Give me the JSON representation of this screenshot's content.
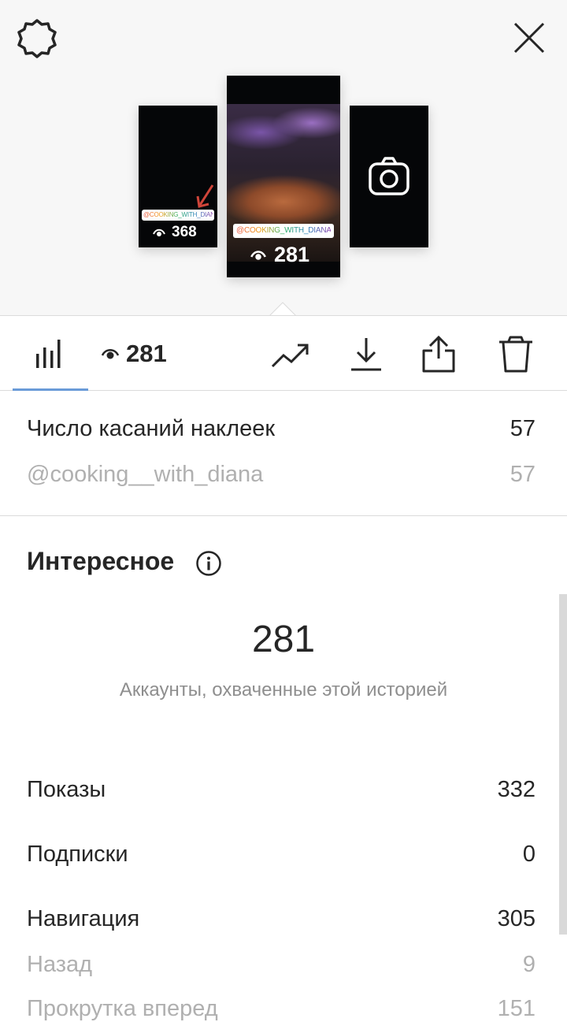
{
  "header": {
    "settings_icon": "gear-icon",
    "close_icon": "close-icon"
  },
  "stories": [
    {
      "tag": "@COOKING_WITH_DIANA",
      "views": "368"
    },
    {
      "tag": "@COOKING_WITH_DIANA",
      "views": "281"
    },
    {
      "icon": "camera-icon"
    }
  ],
  "toolbar": {
    "views_count": "281",
    "icons": [
      "bar-chart-icon",
      "eye-icon",
      "trending-icon",
      "download-icon",
      "share-icon",
      "trash-icon"
    ],
    "active_tab_color": "#6a9bd8"
  },
  "sticker_taps": {
    "label": "Число касаний наклеек",
    "value": "57",
    "sub_label": "@cooking__with_diana",
    "sub_value": "57"
  },
  "discovery": {
    "title": "Интересное",
    "reach": "281",
    "reach_label": "Аккаунты, охваченные этой историей",
    "rows": [
      {
        "label": "Показы",
        "value": "332"
      },
      {
        "label": "Подписки",
        "value": "0"
      },
      {
        "label": "Навигация",
        "value": "305"
      },
      {
        "label": "Назад",
        "value": "9"
      },
      {
        "label": "Прокрутка вперед",
        "value": "151"
      }
    ]
  }
}
